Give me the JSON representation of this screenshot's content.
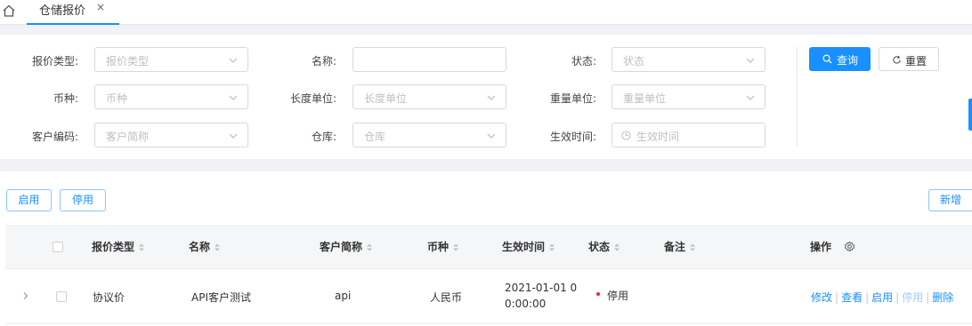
{
  "tabs": {
    "active_label": "仓储报价",
    "close_glyph": "×"
  },
  "filters": {
    "quote_type": {
      "label": "报价类型:",
      "placeholder": "报价类型"
    },
    "name": {
      "label": "名称:",
      "value": ""
    },
    "status": {
      "label": "状态:",
      "placeholder": "状态"
    },
    "currency": {
      "label": "币种:",
      "placeholder": "币种"
    },
    "length_unit": {
      "label": "长度单位:",
      "placeholder": "长度单位"
    },
    "weight_unit": {
      "label": "重量单位:",
      "placeholder": "重量单位"
    },
    "customer_code": {
      "label": "客户编码:",
      "placeholder": "客户简称"
    },
    "warehouse": {
      "label": "仓库:",
      "placeholder": "仓库"
    },
    "effective_time": {
      "label": "生效时间:",
      "placeholder": "生效时间"
    }
  },
  "actions": {
    "query": "查询",
    "reset": "重置"
  },
  "toolbar": {
    "enable": "启用",
    "disable": "停用",
    "add": "新增"
  },
  "table": {
    "columns": [
      "报价类型",
      "名称",
      "客户简称",
      "币种",
      "生效时间",
      "状态",
      "备注",
      "操作"
    ],
    "rows": [
      {
        "quote_type": "协议价",
        "name": "API客户测试",
        "customer": "api",
        "currency": "人民币",
        "effective_line1": "2021-01-01 0",
        "effective_line2": "0:00:00",
        "status": "停用",
        "status_color": "#f5222d",
        "remark": "",
        "ops": {
          "edit": "修改",
          "view": "查看",
          "enable": "启用",
          "disable": "停用",
          "delete": "删除"
        }
      }
    ]
  },
  "colors": {
    "primary": "#1890ff",
    "bg_gray": "#f0f2f5"
  }
}
